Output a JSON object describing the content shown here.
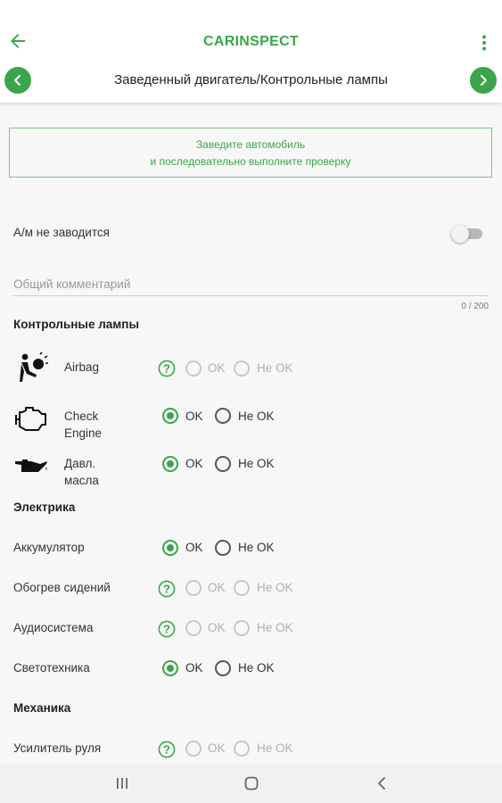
{
  "app": {
    "brand": "CARINSPECT"
  },
  "header": {
    "section_title": "Заведенный двигатель/Контрольные лампы"
  },
  "notice": {
    "line1": "Заведите автомобиль",
    "line2": "и последовательно выполните проверку"
  },
  "engine_toggle": {
    "label": "А/м не заводится",
    "on": false
  },
  "comment": {
    "placeholder": "Общий комментарий",
    "value": "",
    "counter": "0 / 200"
  },
  "sections": [
    {
      "title": "Контрольные лампы",
      "items": [
        {
          "name": "Airbag",
          "label_lines": [
            "Airbag"
          ],
          "icon": "airbag-icon",
          "state": "unset"
        },
        {
          "name": "Check Engine",
          "label_lines": [
            "Check",
            "Engine"
          ],
          "icon": "check-engine-icon",
          "state": "ok"
        },
        {
          "name": "Давл. масла",
          "label_lines": [
            "Давл.",
            "масла"
          ],
          "icon": "oil-pressure-icon",
          "state": "ok"
        }
      ]
    },
    {
      "title": "Электрика",
      "items": [
        {
          "name": "Аккумулятор",
          "state": "ok"
        },
        {
          "name": "Обогрев сидений",
          "state": "unset"
        },
        {
          "name": "Аудиосистема",
          "state": "unset"
        },
        {
          "name": "Светотехника",
          "state": "ok"
        }
      ]
    },
    {
      "title": "Механика",
      "items": [
        {
          "name": "Усилитель руля",
          "state": "unset"
        }
      ]
    }
  ],
  "options": {
    "ok": "OK",
    "not_ok": "Не OK"
  },
  "colors": {
    "accent": "#3aa64a",
    "background": "#f7f7f7",
    "disabled": "#c8c8c8"
  },
  "icons": {
    "back": "back-arrow-icon",
    "menu": "more-vert-icon",
    "hint": "question-circle-icon"
  }
}
